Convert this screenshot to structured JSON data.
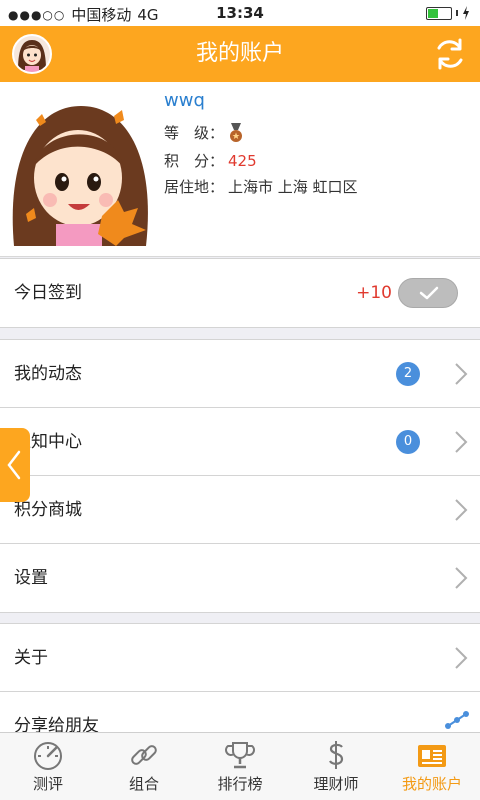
{
  "status": {
    "signal": "●●●○○",
    "carrier": "中国移动",
    "network": "4G",
    "time": "13:34"
  },
  "header": {
    "title": "我的账户"
  },
  "profile": {
    "username": "wwq",
    "level_label": "等　级：",
    "points_label": "积　分：",
    "points": "425",
    "location_label": "居住地：",
    "location": "上海市 上海 虹口区"
  },
  "checkin": {
    "label": "今日签到",
    "bonus": "+10"
  },
  "menu1": [
    {
      "label": "我的动态",
      "badge": "2"
    },
    {
      "label": "通知中心",
      "badge": "0"
    },
    {
      "label": "积分商城"
    },
    {
      "label": "设置"
    }
  ],
  "menu2": [
    {
      "label": "关于"
    },
    {
      "label": "分享给朋友"
    }
  ],
  "tabs": [
    {
      "label": "测评",
      "icon": "gauge-icon"
    },
    {
      "label": "组合",
      "icon": "link-icon"
    },
    {
      "label": "排行榜",
      "icon": "trophy-icon"
    },
    {
      "label": "理财师",
      "icon": "dollar-icon"
    },
    {
      "label": "我的账户",
      "icon": "account-card-icon"
    }
  ],
  "colors": {
    "accent": "#fda61f",
    "active_tab": "#f39a15",
    "badge": "#4a8fdc",
    "points": "#e03a2f",
    "username": "#2a7fcf"
  }
}
